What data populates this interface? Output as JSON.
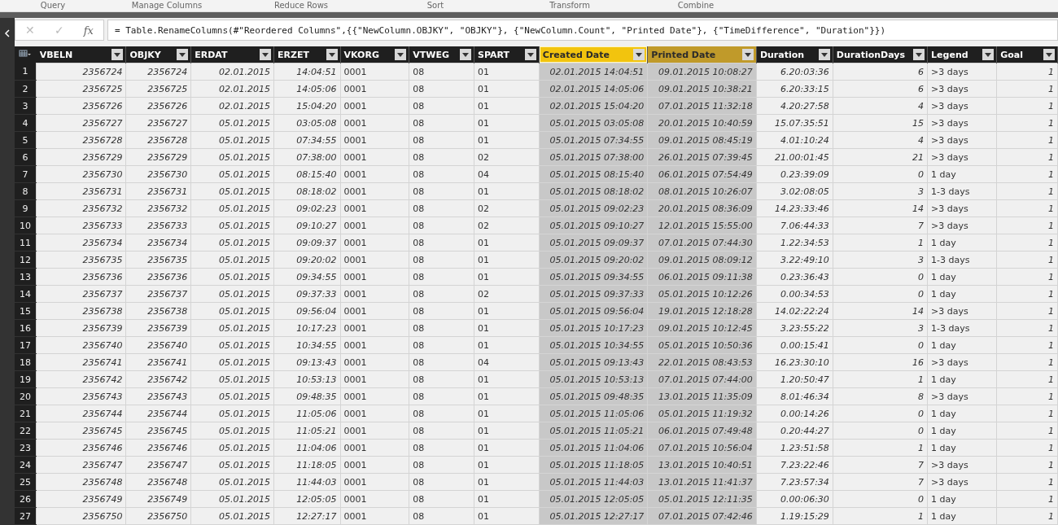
{
  "ribbon_groups": [
    "Query",
    "Manage Columns",
    "Reduce Rows",
    "Sort",
    "Transform",
    "Combine"
  ],
  "formula_bar": {
    "cancel": "✕",
    "confirm": "✓",
    "fx": "fx",
    "formula": "= Table.RenameColumns(#\"Reordered Columns\",{{\"NewColumn.OBJKY\", \"OBJKY\"}, {\"NewColumn.Count\", \"Printed Date\"}, {\"TimeDifference\", \"Duration\"}})"
  },
  "table": {
    "columns": [
      {
        "label": "VBELN",
        "kind": "number",
        "selected": false,
        "focused": false
      },
      {
        "label": "OBJKY",
        "kind": "number",
        "selected": false,
        "focused": false
      },
      {
        "label": "ERDAT",
        "kind": "number",
        "selected": false,
        "focused": false
      },
      {
        "label": "ERZET",
        "kind": "number",
        "selected": false,
        "focused": false
      },
      {
        "label": "VKORG",
        "kind": "text",
        "selected": false,
        "focused": false
      },
      {
        "label": "VTWEG",
        "kind": "text",
        "selected": false,
        "focused": false
      },
      {
        "label": "SPART",
        "kind": "text",
        "selected": false,
        "focused": false
      },
      {
        "label": "Created Date",
        "kind": "number",
        "selected": true,
        "focused": true
      },
      {
        "label": "Printed Date",
        "kind": "number",
        "selected": true,
        "focused": false
      },
      {
        "label": "Duration",
        "kind": "number",
        "selected": false,
        "focused": false
      },
      {
        "label": "DurationDays",
        "kind": "number",
        "selected": false,
        "focused": false
      },
      {
        "label": "Legend",
        "kind": "text",
        "selected": false,
        "focused": false
      },
      {
        "label": "Goal",
        "kind": "number",
        "selected": false,
        "focused": false
      }
    ],
    "rows": [
      {
        "n": "1",
        "cells": [
          "2356724",
          "2356724",
          "02.01.2015",
          "14:04:51",
          "0001",
          "08",
          "01",
          "02.01.2015 14:04:51",
          "09.01.2015 10:08:27",
          "6.20:03:36",
          "6",
          ">3 days",
          "1"
        ]
      },
      {
        "n": "2",
        "cells": [
          "2356725",
          "2356725",
          "02.01.2015",
          "14:05:06",
          "0001",
          "08",
          "01",
          "02.01.2015 14:05:06",
          "09.01.2015 10:38:21",
          "6.20:33:15",
          "6",
          ">3 days",
          "1"
        ]
      },
      {
        "n": "3",
        "cells": [
          "2356726",
          "2356726",
          "02.01.2015",
          "15:04:20",
          "0001",
          "08",
          "01",
          "02.01.2015 15:04:20",
          "07.01.2015 11:32:18",
          "4.20:27:58",
          "4",
          ">3 days",
          "1"
        ]
      },
      {
        "n": "4",
        "cells": [
          "2356727",
          "2356727",
          "05.01.2015",
          "03:05:08",
          "0001",
          "08",
          "01",
          "05.01.2015 03:05:08",
          "20.01.2015 10:40:59",
          "15.07:35:51",
          "15",
          ">3 days",
          "1"
        ]
      },
      {
        "n": "5",
        "cells": [
          "2356728",
          "2356728",
          "05.01.2015",
          "07:34:55",
          "0001",
          "08",
          "01",
          "05.01.2015 07:34:55",
          "09.01.2015 08:45:19",
          "4.01:10:24",
          "4",
          ">3 days",
          "1"
        ]
      },
      {
        "n": "6",
        "cells": [
          "2356729",
          "2356729",
          "05.01.2015",
          "07:38:00",
          "0001",
          "08",
          "02",
          "05.01.2015 07:38:00",
          "26.01.2015 07:39:45",
          "21.00:01:45",
          "21",
          ">3 days",
          "1"
        ]
      },
      {
        "n": "7",
        "cells": [
          "2356730",
          "2356730",
          "05.01.2015",
          "08:15:40",
          "0001",
          "08",
          "04",
          "05.01.2015 08:15:40",
          "06.01.2015 07:54:49",
          "0.23:39:09",
          "0",
          "1 day",
          "1"
        ]
      },
      {
        "n": "8",
        "cells": [
          "2356731",
          "2356731",
          "05.01.2015",
          "08:18:02",
          "0001",
          "08",
          "01",
          "05.01.2015 08:18:02",
          "08.01.2015 10:26:07",
          "3.02:08:05",
          "3",
          "1-3 days",
          "1"
        ]
      },
      {
        "n": "9",
        "cells": [
          "2356732",
          "2356732",
          "05.01.2015",
          "09:02:23",
          "0001",
          "08",
          "02",
          "05.01.2015 09:02:23",
          "20.01.2015 08:36:09",
          "14.23:33:46",
          "14",
          ">3 days",
          "1"
        ]
      },
      {
        "n": "10",
        "cells": [
          "2356733",
          "2356733",
          "05.01.2015",
          "09:10:27",
          "0001",
          "08",
          "02",
          "05.01.2015 09:10:27",
          "12.01.2015 15:55:00",
          "7.06:44:33",
          "7",
          ">3 days",
          "1"
        ]
      },
      {
        "n": "11",
        "cells": [
          "2356734",
          "2356734",
          "05.01.2015",
          "09:09:37",
          "0001",
          "08",
          "01",
          "05.01.2015 09:09:37",
          "07.01.2015 07:44:30",
          "1.22:34:53",
          "1",
          "1 day",
          "1"
        ]
      },
      {
        "n": "12",
        "cells": [
          "2356735",
          "2356735",
          "05.01.2015",
          "09:20:02",
          "0001",
          "08",
          "01",
          "05.01.2015 09:20:02",
          "09.01.2015 08:09:12",
          "3.22:49:10",
          "3",
          "1-3 days",
          "1"
        ]
      },
      {
        "n": "13",
        "cells": [
          "2356736",
          "2356736",
          "05.01.2015",
          "09:34:55",
          "0001",
          "08",
          "01",
          "05.01.2015 09:34:55",
          "06.01.2015 09:11:38",
          "0.23:36:43",
          "0",
          "1 day",
          "1"
        ]
      },
      {
        "n": "14",
        "cells": [
          "2356737",
          "2356737",
          "05.01.2015",
          "09:37:33",
          "0001",
          "08",
          "02",
          "05.01.2015 09:37:33",
          "05.01.2015 10:12:26",
          "0.00:34:53",
          "0",
          "1 day",
          "1"
        ]
      },
      {
        "n": "15",
        "cells": [
          "2356738",
          "2356738",
          "05.01.2015",
          "09:56:04",
          "0001",
          "08",
          "01",
          "05.01.2015 09:56:04",
          "19.01.2015 12:18:28",
          "14.02:22:24",
          "14",
          ">3 days",
          "1"
        ]
      },
      {
        "n": "16",
        "cells": [
          "2356739",
          "2356739",
          "05.01.2015",
          "10:17:23",
          "0001",
          "08",
          "01",
          "05.01.2015 10:17:23",
          "09.01.2015 10:12:45",
          "3.23:55:22",
          "3",
          "1-3 days",
          "1"
        ]
      },
      {
        "n": "17",
        "cells": [
          "2356740",
          "2356740",
          "05.01.2015",
          "10:34:55",
          "0001",
          "08",
          "01",
          "05.01.2015 10:34:55",
          "05.01.2015 10:50:36",
          "0.00:15:41",
          "0",
          "1 day",
          "1"
        ]
      },
      {
        "n": "18",
        "cells": [
          "2356741",
          "2356741",
          "05.01.2015",
          "09:13:43",
          "0001",
          "08",
          "04",
          "05.01.2015 09:13:43",
          "22.01.2015 08:43:53",
          "16.23:30:10",
          "16",
          ">3 days",
          "1"
        ]
      },
      {
        "n": "19",
        "cells": [
          "2356742",
          "2356742",
          "05.01.2015",
          "10:53:13",
          "0001",
          "08",
          "01",
          "05.01.2015 10:53:13",
          "07.01.2015 07:44:00",
          "1.20:50:47",
          "1",
          "1 day",
          "1"
        ]
      },
      {
        "n": "20",
        "cells": [
          "2356743",
          "2356743",
          "05.01.2015",
          "09:48:35",
          "0001",
          "08",
          "01",
          "05.01.2015 09:48:35",
          "13.01.2015 11:35:09",
          "8.01:46:34",
          "8",
          ">3 days",
          "1"
        ]
      },
      {
        "n": "21",
        "cells": [
          "2356744",
          "2356744",
          "05.01.2015",
          "11:05:06",
          "0001",
          "08",
          "01",
          "05.01.2015 11:05:06",
          "05.01.2015 11:19:32",
          "0.00:14:26",
          "0",
          "1 day",
          "1"
        ]
      },
      {
        "n": "22",
        "cells": [
          "2356745",
          "2356745",
          "05.01.2015",
          "11:05:21",
          "0001",
          "08",
          "01",
          "05.01.2015 11:05:21",
          "06.01.2015 07:49:48",
          "0.20:44:27",
          "0",
          "1 day",
          "1"
        ]
      },
      {
        "n": "23",
        "cells": [
          "2356746",
          "2356746",
          "05.01.2015",
          "11:04:06",
          "0001",
          "08",
          "01",
          "05.01.2015 11:04:06",
          "07.01.2015 10:56:04",
          "1.23:51:58",
          "1",
          "1 day",
          "1"
        ]
      },
      {
        "n": "24",
        "cells": [
          "2356747",
          "2356747",
          "05.01.2015",
          "11:18:05",
          "0001",
          "08",
          "01",
          "05.01.2015 11:18:05",
          "13.01.2015 10:40:51",
          "7.23:22:46",
          "7",
          ">3 days",
          "1"
        ]
      },
      {
        "n": "25",
        "cells": [
          "2356748",
          "2356748",
          "05.01.2015",
          "11:44:03",
          "0001",
          "08",
          "01",
          "05.01.2015 11:44:03",
          "13.01.2015 11:41:37",
          "7.23:57:34",
          "7",
          ">3 days",
          "1"
        ]
      },
      {
        "n": "26",
        "cells": [
          "2356749",
          "2356749",
          "05.01.2015",
          "12:05:05",
          "0001",
          "08",
          "01",
          "05.01.2015 12:05:05",
          "05.01.2015 12:11:35",
          "0.00:06:30",
          "0",
          "1 day",
          "1"
        ]
      },
      {
        "n": "27",
        "cells": [
          "2356750",
          "2356750",
          "05.01.2015",
          "12:27:17",
          "0001",
          "08",
          "01",
          "05.01.2015 12:27:17",
          "07.01.2015 07:42:46",
          "1.19:15:29",
          "1",
          "1 day",
          "1"
        ]
      }
    ]
  }
}
